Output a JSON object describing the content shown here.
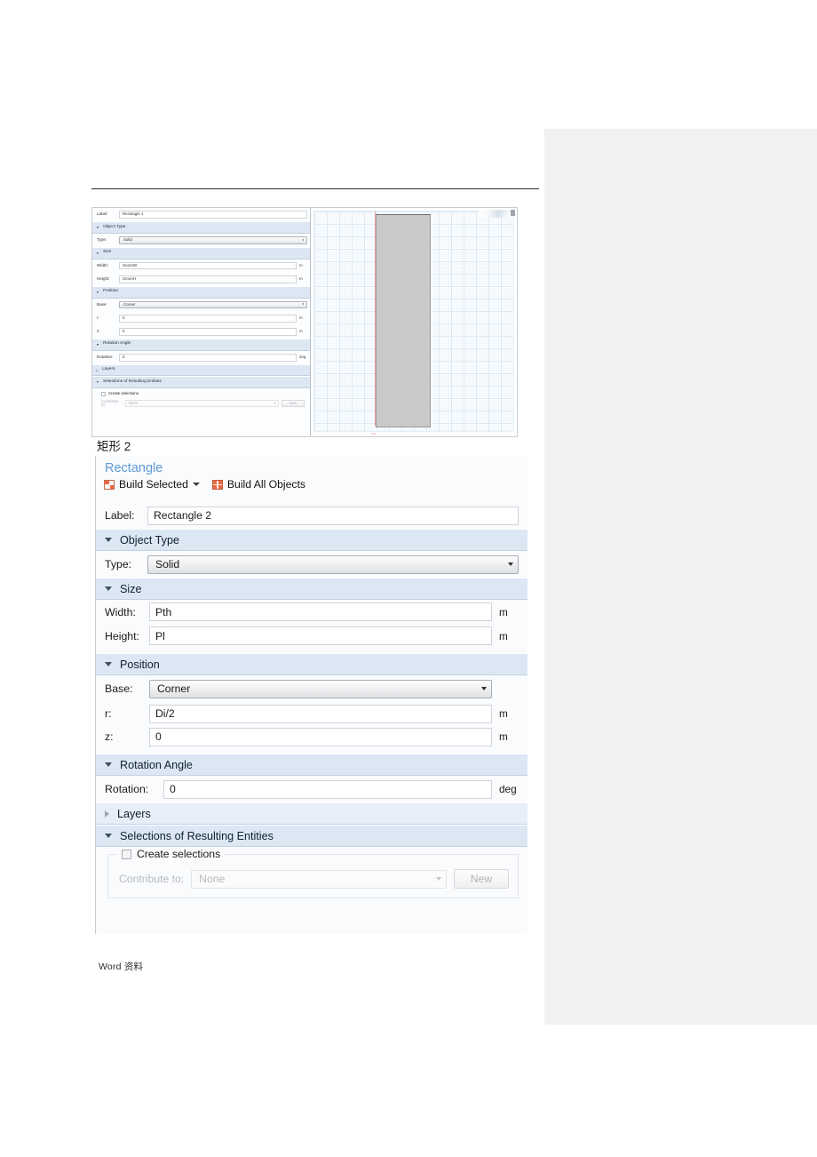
{
  "document": {
    "caption": "矩形 2",
    "footer": "Word 资料"
  },
  "thumbnail_panel": {
    "label_row": {
      "label": "Label:",
      "value": "Rectangle 1"
    },
    "sections": {
      "object_type": "Object Type",
      "size": "Size",
      "position": "Position",
      "rotation_angle": "Rotation Angle",
      "layers": "Layers",
      "selections": "Selections of Resulting Entities"
    },
    "type": {
      "label": "Type:",
      "value": "Solid"
    },
    "width": {
      "label": "Width:",
      "value": "GeomW",
      "unit": "m"
    },
    "height": {
      "label": "Height:",
      "value": "GeomH",
      "unit": "m"
    },
    "base": {
      "label": "Base:",
      "value": "Corner"
    },
    "r": {
      "label": "r:",
      "value": "0",
      "unit": "m"
    },
    "z": {
      "label": "z:",
      "value": "0",
      "unit": "m"
    },
    "rotation": {
      "label": "Rotation:",
      "value": "0",
      "unit": "deg"
    },
    "create_selections": "Create selections",
    "contribute_to": {
      "label": "Contribute to:",
      "value": "None"
    },
    "new_button": "New",
    "graphics": {
      "origin_label": "r=0"
    }
  },
  "settings_panel": {
    "title": "Rectangle",
    "toolbar": {
      "build_selected": "Build Selected",
      "build_all_objects": "Build All Objects"
    },
    "label_row": {
      "label": "Label:",
      "value": "Rectangle 2"
    },
    "sections": {
      "object_type": "Object Type",
      "size": "Size",
      "position": "Position",
      "rotation_angle": "Rotation Angle",
      "layers": "Layers",
      "selections": "Selections of Resulting Entities"
    },
    "type": {
      "label": "Type:",
      "value": "Solid"
    },
    "width": {
      "label": "Width:",
      "value": "Pth",
      "unit": "m"
    },
    "height": {
      "label": "Height:",
      "value": "Pl",
      "unit": "m"
    },
    "base": {
      "label": "Base:",
      "value": "Corner"
    },
    "r": {
      "label": "r:",
      "value": "Di/2",
      "unit": "m"
    },
    "z": {
      "label": "z:",
      "value": "0",
      "unit": "m"
    },
    "rotation": {
      "label": "Rotation:",
      "value": "0",
      "unit": "deg"
    },
    "create_selections": "Create selections",
    "contribute_to": {
      "label": "Contribute to:",
      "value": "None"
    },
    "new_button": "New"
  },
  "colors": {
    "section_header": "#dce7f4",
    "title_blue": "#5b9bd5",
    "build_icon": "#ea6a43",
    "right_panel": "#f1f1f1",
    "geometry_fill": "#c9c9c9",
    "axis_red": "#e7a6a6"
  }
}
